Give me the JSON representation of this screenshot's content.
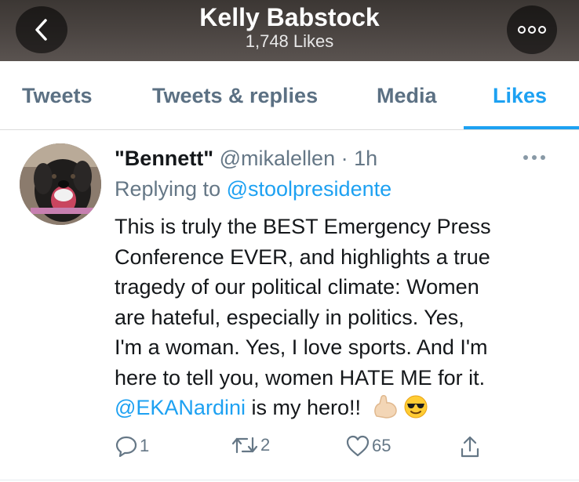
{
  "header": {
    "title": "Kelly Babstock",
    "subtitle": "1,748 Likes",
    "back_icon": "chevron-left-icon",
    "more_icon": "more-horizontal-icon"
  },
  "tabs": [
    {
      "label": "Tweets",
      "active": false
    },
    {
      "label": "Tweets & replies",
      "active": false
    },
    {
      "label": "Media",
      "active": false
    },
    {
      "label": "Likes",
      "active": true
    }
  ],
  "tweet": {
    "display_name": "\"Bennett\"",
    "handle": "@mikalellen",
    "separator": "·",
    "time": "1h",
    "replying_prefix": "Replying to ",
    "replying_to": "@stoolpresidente",
    "text_lines": [
      "This is truly the BEST Emergency Press",
      "Conference EVER, and highlights a true",
      "tragedy of our political climate:  Women",
      "are hateful, especially in politics.  Yes,",
      "I'm a woman.  Yes, I love sports.  And I'm",
      "here to tell you, women HATE ME for it."
    ],
    "last_line_mention": "@EKANardini",
    "last_line_text": " is my hero!!",
    "emojis": [
      "flexed-biceps-emoji",
      "sunglasses-face-emoji"
    ],
    "more_icon": "more-horizontal-icon",
    "actions": {
      "reply_count": "1",
      "retweet_count": "2",
      "like_count": "65",
      "share_icon": "share-icon"
    }
  },
  "colors": {
    "accent": "#1da1f2",
    "muted": "#657786",
    "text": "#14171a"
  }
}
